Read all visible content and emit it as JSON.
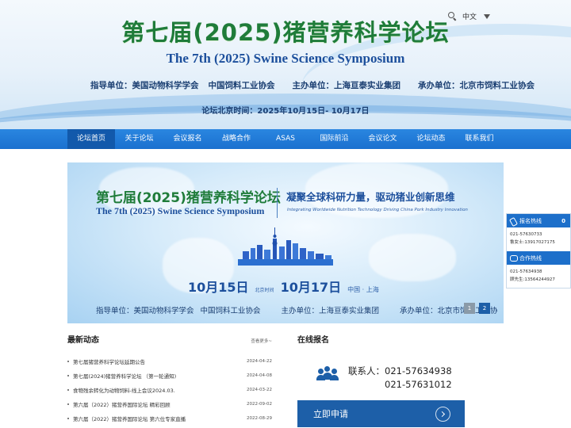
{
  "header": {
    "title": "第七届(2025)猪营养科学论坛",
    "subtitle": "The 7th (2025) Swine Science Symposium",
    "guide_label": "指导单位：美国动物科学学会",
    "guide_org2": "中国饲料工业协会",
    "host_label": "主办单位：上海亘泰实业集团",
    "organizer_label": "承办单位：北京市饲料工业协会",
    "time_label": "论坛北京时间：2025年10月15日- 10月17日",
    "language": "中文",
    "icons": {
      "search": "search-icon",
      "language_caret": "caret-down-icon"
    }
  },
  "nav": {
    "items": [
      {
        "label": "论坛首页",
        "active": true
      },
      {
        "label": "关于论坛"
      },
      {
        "label": "会议报名"
      },
      {
        "label": "战略合作"
      },
      {
        "label": "ASAS"
      },
      {
        "label": "国际前沿"
      },
      {
        "label": "会议论文"
      },
      {
        "label": "论坛动态"
      },
      {
        "label": "联系我们"
      }
    ]
  },
  "banner": {
    "title": "第七届(2025)猪营养科学论坛",
    "subtitle": "The 7th (2025) Swine Science Symposium",
    "slogan": "凝聚全球科研力量，驱动猪业创新思维",
    "slogan_en": "Integrating Worldwide Nutrition Technology Driving China Pork Industry Innovation",
    "date_start": "10月15日",
    "date_mid": "北京时间",
    "date_end": "10月17日",
    "location": "中国 · 上海",
    "guide": "指导单位：美国动物科学学会",
    "guide2": "中国饲料工业协会",
    "host": "主办单位：上海亘泰实业集团",
    "organizer": "承办单位：北京市饲料工业协",
    "dots": [
      "1",
      "2"
    ]
  },
  "side_panel": {
    "hotline_title": "报名热线",
    "hotline_extra": "0",
    "hotline_phone": "021-57630733",
    "hotline_person": "鲁女士:13917027175",
    "coop_title": "合作热线",
    "coop_phone": "021-57634938",
    "coop_person": "顾先生:13564244927"
  },
  "news": {
    "title": "最新动态",
    "more": "查看更多~",
    "items": [
      {
        "title": "第七届猪营养科学论坛延期公告",
        "date": "2024-04-22"
      },
      {
        "title": "第七届(2024)猪营养科学论坛 （第一轮通知)",
        "date": "2024-04-08"
      },
      {
        "title": "食物残余转化为动物饲料-线上会议2024.03.",
        "date": "2024-03-22"
      },
      {
        "title": "第六届（2022）猪营养国际论坛 精彩回顾",
        "date": "2022-09-02"
      },
      {
        "title": "第六届（2022）猪营养国际论坛 第六位专家直播",
        "date": "2022-08-29"
      }
    ]
  },
  "registration": {
    "title": "在线报名",
    "contact_label": "联系人：021-57634938",
    "contact_phone2": "021-57631012",
    "apply_label": "立即申请"
  }
}
